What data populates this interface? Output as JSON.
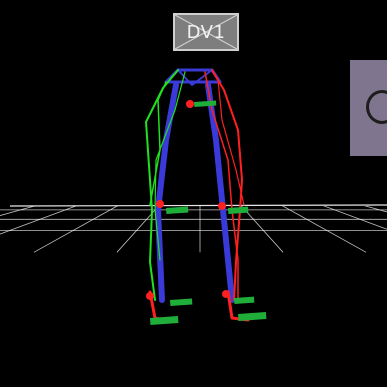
{
  "viewer": {
    "device_label": "DV1",
    "colors": {
      "background": "#000000",
      "grid": "#ffffff",
      "left_side": "#21e021",
      "right_side": "#ff2020",
      "center": "#3a3ad8",
      "marker_green": "#1fae3a",
      "label_bg": "#7e7e7e",
      "panel": "#80758e"
    },
    "icons": [
      "ring-icon"
    ]
  }
}
